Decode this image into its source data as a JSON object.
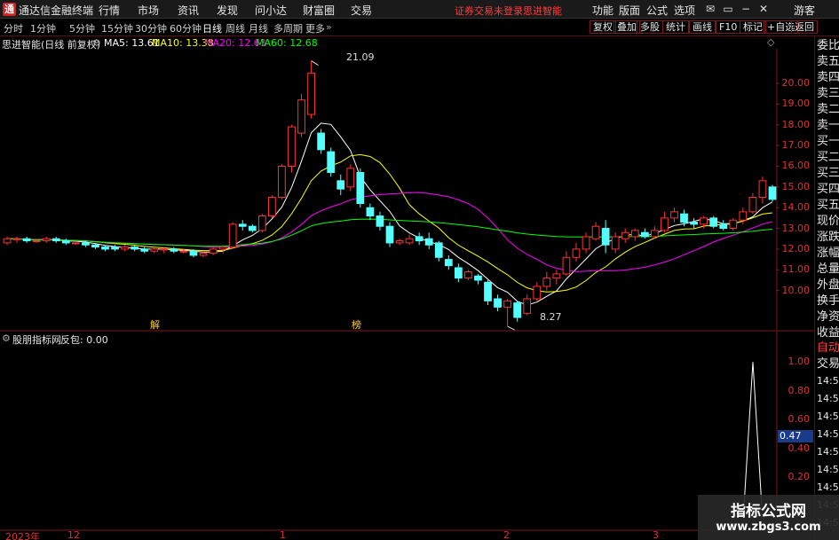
{
  "app": {
    "logo": "通",
    "title": "通达信金融终端",
    "menu": [
      "行情",
      "市场",
      "资讯",
      "发现",
      "问小达",
      "财富圈",
      "交易"
    ],
    "notice_login": "证券交易未登录",
    "notice_brand": "思进智能",
    "right_menu": [
      "功能",
      "版面",
      "公式",
      "选项"
    ],
    "guest": "游客"
  },
  "periods": [
    "分时",
    "1分钟",
    "5分钟",
    "15分钟",
    "30分钟",
    "60分钟",
    "日线",
    "周线",
    "月线",
    "多周期",
    "更多"
  ],
  "active_period": "日线",
  "toolbar": [
    "复权",
    "叠加",
    "多股",
    "统计",
    "画线",
    "F10",
    "标记",
    "+自选",
    "返回"
  ],
  "main_legend": {
    "title": "思进智能(日线 前复权)",
    "ma5": "MA5: 13.61",
    "ma10": "MA10: 13.38",
    "ma20": "MA20: 12.63",
    "ma60": "MA60: 12.68"
  },
  "sub_legend": {
    "title": "股朋指标网",
    "indicator": "反包: 0.00"
  },
  "right_panel": {
    "quote_labels": [
      "委比",
      "卖五",
      "卖四",
      "卖三",
      "卖二",
      "卖一",
      "买一",
      "买二",
      "买三",
      "买四",
      "买五",
      "现价",
      "涨跌",
      "涨幅",
      "总量",
      "外盘",
      "换手",
      "净资",
      "收益"
    ],
    "tabs": [
      "自动",
      "交易"
    ],
    "times": [
      "14:56",
      "14:56",
      "14:56",
      "14:56",
      "14:56",
      "14:56",
      "14:56",
      "14:56",
      "14:5"
    ]
  },
  "colors": {
    "up": "#ff3232",
    "down": "#54ffff",
    "ma5": "#ffffff",
    "ma10": "#ffff00",
    "ma20": "#ff00ff",
    "ma60": "#00ff00",
    "axis": "#d33333"
  },
  "annotations": {
    "high_label": "21.09",
    "low_label": "8.27",
    "event1": "解",
    "event2": "榜",
    "current_value": "0.47"
  },
  "chart_data": [
    {
      "type": "candlestick",
      "ylim": [
        9.0,
        21.5
      ],
      "y_ticks": [
        "20.00",
        "19.00",
        "18.00",
        "17.00",
        "16.00",
        "15.00",
        "14.00",
        "13.00",
        "12.00",
        "11.00",
        "10.00"
      ],
      "x_ticks": [
        "2023年",
        "12",
        "1",
        "2",
        "3"
      ],
      "candles": [
        [
          12.3,
          12.5,
          12.2,
          12.6
        ],
        [
          12.5,
          12.5,
          12.3,
          12.6
        ],
        [
          12.5,
          12.4,
          12.3,
          12.6
        ],
        [
          12.4,
          12.4,
          12.3,
          12.5
        ],
        [
          12.4,
          12.5,
          12.3,
          12.6
        ],
        [
          12.5,
          12.4,
          12.3,
          12.6
        ],
        [
          12.4,
          12.3,
          12.2,
          12.5
        ],
        [
          12.3,
          12.3,
          12.2,
          12.4
        ],
        [
          12.3,
          12.2,
          12.1,
          12.4
        ],
        [
          12.2,
          12.1,
          12.0,
          12.3
        ],
        [
          12.1,
          12.0,
          11.9,
          12.2
        ],
        [
          12.1,
          12.0,
          11.9,
          12.2
        ],
        [
          12.0,
          12.1,
          11.9,
          12.2
        ],
        [
          12.1,
          12.0,
          11.9,
          12.2
        ],
        [
          12.0,
          11.9,
          11.8,
          12.1
        ],
        [
          11.9,
          12.0,
          11.8,
          12.1
        ],
        [
          12.0,
          12.0,
          11.8,
          12.1
        ],
        [
          12.0,
          11.9,
          11.8,
          12.1
        ],
        [
          11.9,
          11.9,
          11.8,
          12.0
        ],
        [
          11.9,
          11.7,
          11.6,
          12.0
        ],
        [
          11.7,
          11.8,
          11.6,
          11.9
        ],
        [
          11.8,
          12.0,
          11.7,
          12.1
        ],
        [
          12.0,
          12.1,
          11.8,
          12.2
        ],
        [
          12.1,
          13.2,
          12.0,
          13.3
        ],
        [
          13.2,
          13.1,
          12.9,
          13.4
        ],
        [
          13.1,
          12.9,
          12.8,
          13.2
        ],
        [
          12.9,
          13.6,
          12.8,
          13.7
        ],
        [
          13.6,
          14.5,
          13.5,
          14.6
        ],
        [
          14.5,
          16.0,
          14.4,
          16.1
        ],
        [
          16.0,
          17.9,
          15.7,
          18.0
        ],
        [
          17.6,
          19.2,
          17.4,
          19.5
        ],
        [
          18.5,
          20.5,
          18.3,
          21.09
        ],
        [
          17.6,
          16.8,
          16.6,
          17.8
        ],
        [
          16.7,
          15.7,
          15.5,
          16.9
        ],
        [
          15.3,
          14.9,
          14.6,
          15.6
        ],
        [
          15.0,
          15.9,
          14.8,
          16.1
        ],
        [
          15.7,
          14.2,
          14.0,
          15.9
        ],
        [
          14.0,
          13.6,
          13.4,
          14.2
        ],
        [
          13.6,
          13.1,
          12.9,
          13.8
        ],
        [
          13.1,
          12.3,
          12.1,
          13.3
        ],
        [
          12.3,
          12.4,
          12.2,
          12.5
        ],
        [
          12.3,
          12.5,
          12.2,
          12.7
        ],
        [
          12.6,
          12.4,
          12.2,
          12.8
        ],
        [
          12.5,
          12.2,
          12.0,
          12.8
        ],
        [
          12.3,
          11.6,
          11.4,
          12.4
        ],
        [
          11.5,
          11.2,
          11.0,
          11.7
        ],
        [
          11.1,
          10.6,
          10.4,
          11.3
        ],
        [
          10.6,
          10.9,
          10.5,
          11.0
        ],
        [
          10.7,
          10.5,
          10.3,
          10.8
        ],
        [
          10.4,
          9.5,
          9.3,
          10.5
        ],
        [
          9.6,
          9.2,
          9.0,
          9.8
        ],
        [
          9.2,
          9.5,
          8.27,
          9.6
        ],
        [
          9.4,
          8.7,
          8.5,
          9.5
        ],
        [
          8.9,
          9.6,
          8.8,
          9.8
        ],
        [
          9.6,
          10.2,
          9.5,
          10.4
        ],
        [
          10.2,
          10.6,
          10.0,
          10.9
        ],
        [
          10.6,
          10.8,
          10.3,
          11.0
        ],
        [
          10.8,
          11.6,
          10.7,
          11.9
        ],
        [
          11.6,
          12.0,
          11.4,
          12.3
        ],
        [
          12.0,
          12.6,
          11.8,
          12.8
        ],
        [
          12.5,
          13.1,
          12.4,
          13.3
        ],
        [
          13.0,
          12.2,
          11.8,
          13.4
        ],
        [
          12.0,
          12.6,
          11.8,
          12.8
        ],
        [
          12.5,
          12.8,
          12.3,
          13.0
        ],
        [
          12.6,
          12.9,
          12.4,
          13.0
        ],
        [
          12.8,
          12.6,
          12.5,
          13.0
        ],
        [
          12.6,
          12.9,
          12.5,
          13.1
        ],
        [
          12.9,
          13.5,
          12.8,
          13.8
        ],
        [
          13.5,
          13.8,
          13.3,
          14.0
        ],
        [
          13.7,
          13.3,
          13.1,
          13.9
        ],
        [
          13.3,
          13.2,
          13.0,
          13.5
        ],
        [
          13.2,
          13.5,
          13.0,
          13.6
        ],
        [
          13.5,
          13.1,
          13.0,
          13.6
        ],
        [
          13.2,
          13.0,
          12.9,
          13.4
        ],
        [
          13.0,
          13.4,
          12.9,
          13.5
        ],
        [
          13.4,
          13.8,
          13.2,
          14.0
        ],
        [
          13.8,
          14.5,
          13.7,
          14.7
        ],
        [
          14.5,
          15.3,
          14.2,
          15.5
        ],
        [
          15.0,
          14.4,
          14.3,
          15.1
        ]
      ]
    },
    {
      "type": "line",
      "ylim": [
        0,
        1.1
      ],
      "y_ticks": [
        "1.00",
        "0.80",
        "0.60",
        "0.40",
        "0.20"
      ],
      "series": [
        {
          "values": [
            0.0,
            1.0,
            0.0
          ]
        }
      ]
    }
  ]
}
